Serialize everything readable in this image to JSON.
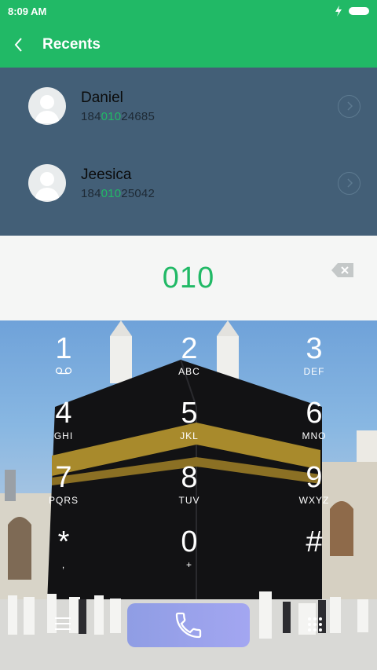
{
  "status_bar": {
    "time": "8:09 AM",
    "icons": [
      "charging-icon",
      "battery-icon"
    ]
  },
  "header": {
    "title": "Recents",
    "back_icon": "chevron-left-icon"
  },
  "recents": [
    {
      "name": "Daniel",
      "number_prefix": "184",
      "number_match": "010",
      "number_suffix": "24685"
    },
    {
      "name": "Jeesica",
      "number_prefix": "184",
      "number_match": "010",
      "number_suffix": "25042"
    }
  ],
  "input": {
    "value": "010"
  },
  "keypad": {
    "keys": [
      {
        "digit": "1",
        "letters": ""
      },
      {
        "digit": "2",
        "letters": "ABC"
      },
      {
        "digit": "3",
        "letters": "DEF"
      },
      {
        "digit": "4",
        "letters": "GHI"
      },
      {
        "digit": "5",
        "letters": "JKL"
      },
      {
        "digit": "6",
        "letters": "MNO"
      },
      {
        "digit": "7",
        "letters": "PQRS"
      },
      {
        "digit": "8",
        "letters": "TUV"
      },
      {
        "digit": "9",
        "letters": "WXYZ"
      },
      {
        "digit": "*",
        "letters": ","
      },
      {
        "digit": "0",
        "letters": "+"
      },
      {
        "digit": "#",
        "letters": ""
      }
    ]
  },
  "colors": {
    "accent": "#21b966",
    "recents_bg": "#435f77",
    "call_button": "#9aa2ec"
  }
}
